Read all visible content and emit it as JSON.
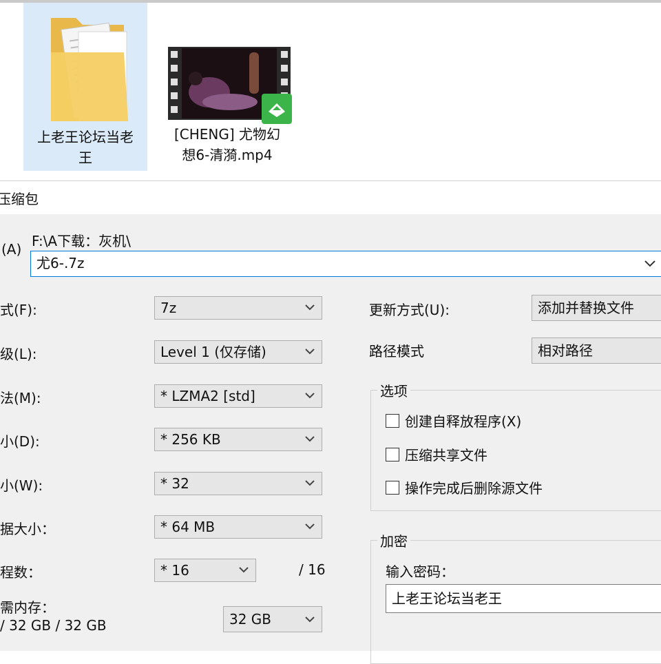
{
  "explorer": {
    "files": [
      {
        "name_line1": "上老王论坛当老",
        "name_line2": "王",
        "icon": "folder-icon"
      },
      {
        "name_line1": "[CHENG] 尤物幻",
        "name_line2": "想6-清漪.mp4",
        "icon": "video-thumbnail"
      }
    ]
  },
  "dialog": {
    "title": "压缩包",
    "archive": {
      "label": "(A)",
      "path": "F:\\A下载：灰机\\",
      "value": "尤6-.7z"
    },
    "left_fields": [
      {
        "label": "式(F):",
        "value": "7z"
      },
      {
        "label": "级(L):",
        "value": "Level 1 (仅存储)"
      },
      {
        "label": "法(M):",
        "value": "*  LZMA2 [std]"
      },
      {
        "label": "小(D):",
        "value": "*  256 KB"
      },
      {
        "label": "小(W):",
        "value": "*  32"
      },
      {
        "label": "据大小：",
        "value": "*  64 MB"
      }
    ],
    "threads": {
      "label": "程数：",
      "value": "*  16",
      "max": "/ 16"
    },
    "memory": {
      "label": "需内存：",
      "detail": "/ 32 GB / 32 GB",
      "value": "32 GB"
    },
    "update_mode": {
      "label": "更新方式(U):",
      "value": "添加并替换文件"
    },
    "path_mode": {
      "label": "路径模式",
      "value": "相对路径"
    },
    "options": {
      "title": "选项",
      "items": [
        {
          "label": "创建自释放程序(X)",
          "checked": false
        },
        {
          "label": "压缩共享文件",
          "checked": false
        },
        {
          "label": "操作完成后删除源文件",
          "checked": false
        }
      ]
    },
    "encryption": {
      "title": "加密",
      "password_label": "输入密码：",
      "password_value": "上老王论坛当老王"
    }
  },
  "colors": {
    "selection": "#dbeaf8",
    "dialog_bg": "#f0f0f0",
    "combo_bg": "#e6e6e6",
    "input_focus": "#0078d7"
  }
}
